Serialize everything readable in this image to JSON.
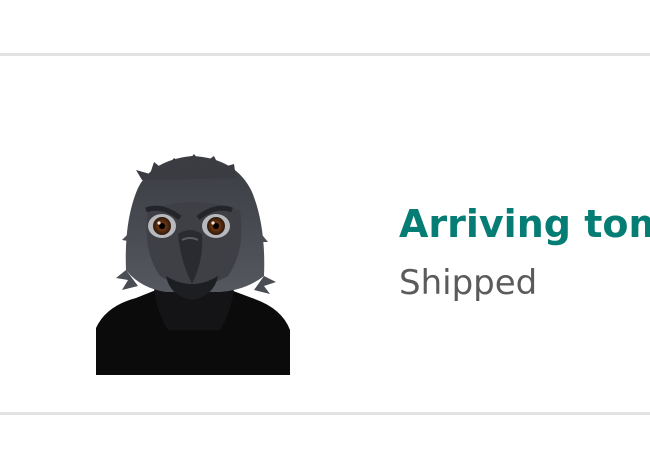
{
  "order": {
    "status_title": "Arriving tomorrow",
    "status_subtitle": "Shipped",
    "product_image": "crow-mask-product-photo"
  },
  "colors": {
    "status_title": "#067d74",
    "status_subtitle": "#5b5b5b",
    "divider": "#e3e3e3",
    "background": "#ffffff"
  }
}
